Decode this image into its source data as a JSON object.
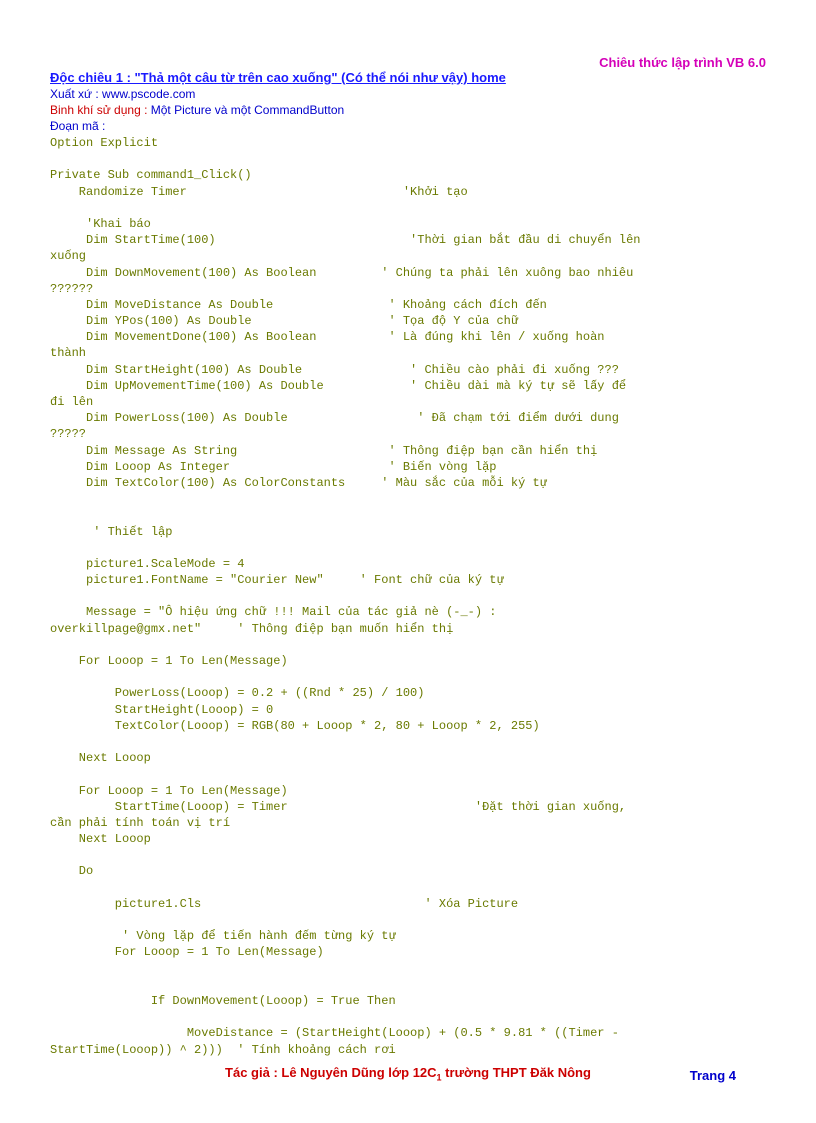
{
  "header": {
    "right": "Chiêu thức lập trình VB 6.0"
  },
  "title": "Độc chiêu 1 : \"Thả một câu từ trên cao xuống\" (Có thể nói như vậy)  home",
  "source_label": "Xuất xứ : www.pscode.com",
  "equip": {
    "label": "Binh khí sử dụng : ",
    "value": "Một Picture và một CommandButton"
  },
  "section_label": "Đoạn mã :",
  "code": "Option Explicit\n\nPrivate Sub command1_Click()\n    Randomize Timer                              'Khởi tạo\n\n     'Khai báo\n     Dim StartTime(100)                           'Thời gian bắt đầu di chuyển lên\nxuống\n     Dim DownMovement(100) As Boolean         ' Chúng ta phải lên xuông bao nhiêu\n??????\n     Dim MoveDistance As Double                ' Khoảng cách đích đến\n     Dim YPos(100) As Double                   ' Tọa độ Y của chữ\n     Dim MovementDone(100) As Boolean          ' Là đúng khi lên / xuống hoàn\nthành\n     Dim StartHeight(100) As Double               ' Chiều cào phải đi xuống ???\n     Dim UpMovementTime(100) As Double            ' Chiều dài mà ký tự sẽ lấy để\nđi lên\n     Dim PowerLoss(100) As Double                  ' Đã chạm tới điểm dưới dung\n?????\n     Dim Message As String                     ' Thông điệp bạn cần hiển thị\n     Dim Looop As Integer                      ' Biến vòng lặp\n     Dim TextColor(100) As ColorConstants     ' Màu sắc của mỗi ký tự\n\n\n      ' Thiết lập\n\n     picture1.ScaleMode = 4\n     picture1.FontName = \"Courier New\"     ' Font chữ của ký tự\n\n     Message = \"Ô hiệu ứng chữ !!! Mail của tác giả nè (-_-) :\noverkillpage@gmx.net\"     ' Thông điệp bạn muốn hiển thị\n\n    For Looop = 1 To Len(Message)\n\n         PowerLoss(Looop) = 0.2 + ((Rnd * 25) / 100)\n         StartHeight(Looop) = 0\n         TextColor(Looop) = RGB(80 + Looop * 2, 80 + Looop * 2, 255)\n\n    Next Looop\n\n    For Looop = 1 To Len(Message)\n         StartTime(Looop) = Timer                          'Đặt thời gian xuống,\ncần phải tính toán vị trí\n    Next Looop\n\n    Do\n\n         picture1.Cls                               ' Xóa Picture\n\n          ' Vòng lặp để tiến hành đếm từng ký tự\n         For Looop = 1 To Len(Message)\n\n\n              If DownMovement(Looop) = True Then\n\n                   MoveDistance = (StartHeight(Looop) + (0.5 * 9.81 * ((Timer -\nStartTime(Looop)) ^ 2)))  ' Tính khoảng cách rơi",
  "footer": {
    "author_pre": "Tác giả : Lê Nguyên Dũng lớp 12C",
    "author_sub": "1",
    "author_post": "  trường THPT Đăk Nông",
    "page": "Trang 4"
  }
}
